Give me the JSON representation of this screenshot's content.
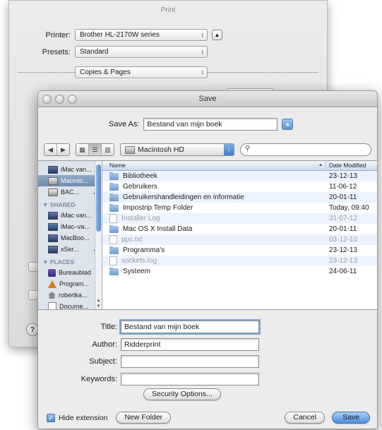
{
  "print": {
    "title": "Print",
    "printer_label": "Printer:",
    "printer_value": "Brother HL-2170W series",
    "presets_label": "Presets:",
    "presets_value": "Standard",
    "section_value": "Copies & Pages",
    "help_label": "?"
  },
  "save": {
    "title": "Save",
    "save_as_label": "Save As:",
    "save_as_value": "Bestand van mijn boek",
    "location": "Macintosh HD",
    "search_placeholder": "",
    "sidebar": {
      "devices": [
        {
          "label": "iMac van...",
          "icon": "display-icon"
        },
        {
          "label": "Macinto...",
          "icon": "hard-disk-icon",
          "selected": true
        },
        {
          "label": "BAC...",
          "icon": "hard-disk-icon",
          "eject": "⏏"
        }
      ],
      "shared_header": "▼ SHARED",
      "shared": [
        {
          "label": "iMac van..."
        },
        {
          "label": "iMac–va..."
        },
        {
          "label": "MacBoo..."
        },
        {
          "label": "xSer...",
          "eject": "⏏"
        }
      ],
      "places_header": "▼ PLACES",
      "places": [
        {
          "label": "Bureaublad",
          "icon": "desktop-icon"
        },
        {
          "label": "Program...",
          "icon": "applications-icon"
        },
        {
          "label": "robertka...",
          "icon": "home-icon"
        },
        {
          "label": "Docume...",
          "icon": "documents-icon"
        }
      ]
    },
    "columns": {
      "name": "Name",
      "date": "Date Modified"
    },
    "files": [
      {
        "name": "Bibliotheek",
        "date": "23-12-13",
        "kind": "folder",
        "dim": false
      },
      {
        "name": "Gebruikers",
        "date": "11-06-12",
        "kind": "folder",
        "dim": false
      },
      {
        "name": "Gebruikershandleidingen en informatie",
        "date": "20-01-11",
        "kind": "folder",
        "dim": false
      },
      {
        "name": "Impostrip Temp Folder",
        "date": "Today, 09:40",
        "kind": "folder",
        "dim": false
      },
      {
        "name": "Installer Log",
        "date": "31-07-12",
        "kind": "file",
        "dim": true
      },
      {
        "name": "Mac OS X Install Data",
        "date": "20-01-11",
        "kind": "folder",
        "dim": false
      },
      {
        "name": "ppc.txt",
        "date": "03-12-10",
        "kind": "file",
        "dim": true
      },
      {
        "name": "Programma's",
        "date": "23-12-13",
        "kind": "folder",
        "dim": false
      },
      {
        "name": "sockets.log",
        "date": "23-12-13",
        "kind": "file",
        "dim": true
      },
      {
        "name": "Systeem",
        "date": "24-06-11",
        "kind": "folder",
        "dim": false
      }
    ],
    "metadata": {
      "title_label": "Title:",
      "title_value": "Bestand van mijn boek",
      "author_label": "Author:",
      "author_value": "Ridderprint",
      "subject_label": "Subject:",
      "subject_value": "",
      "keywords_label": "Keywords:",
      "keywords_value": "",
      "security_button": "Security Options..."
    },
    "hide_extension_label": "Hide extension",
    "hide_extension_checked": true,
    "new_folder_button": "New Folder",
    "cancel_button": "Cancel",
    "save_button": "Save"
  }
}
